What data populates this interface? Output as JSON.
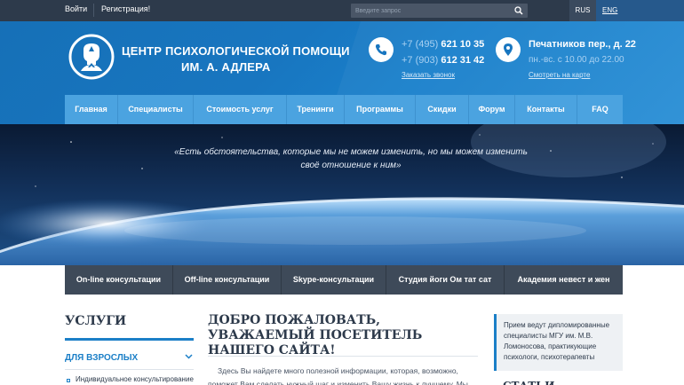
{
  "topbar": {
    "login": "Войти",
    "register": "Регистрация!",
    "search_placeholder": "Введите запрос",
    "lang_rus": "RUS",
    "lang_eng": "ENG"
  },
  "brand": {
    "line1": "ЦЕНТР ПСИХОЛОГИЧЕСКОЙ ПОМОЩИ",
    "line2": "ИМ. А. АДЛЕРА"
  },
  "contacts": {
    "phone1_code": "+7 (495)",
    "phone1_number": "621 10 35",
    "phone2_code": "+7 (903)",
    "phone2_number": "612 31 42",
    "callback": "Заказать звонок",
    "address": "Печатников пер., д. 22",
    "hours": "пн.-вс. с 10.00 до 22.00",
    "map_link": "Смотреть на карте"
  },
  "nav": {
    "items": [
      {
        "label": "Главная"
      },
      {
        "label": "Специалисты"
      },
      {
        "label": "Стоимость услуг"
      },
      {
        "label": "Тренинги"
      },
      {
        "label": "Программы"
      },
      {
        "label": "Скидки"
      },
      {
        "label": "Форум"
      },
      {
        "label": "Контакты"
      },
      {
        "label": "FAQ"
      }
    ]
  },
  "hero": {
    "quote": "«Есть обстоятельства, которые мы не можем изменить, но мы можем изменить своё отношение к ним»"
  },
  "subnav": {
    "items": [
      {
        "label": "On-line консультации"
      },
      {
        "label": "Off-line консультации"
      },
      {
        "label": "Skype-консультации"
      },
      {
        "label": "Студия йоги Ом тат сат"
      },
      {
        "label": "Академия невест и жен"
      }
    ]
  },
  "services": {
    "title": "УСЛУГИ",
    "category": "ДЛЯ ВЗРОСЛЫХ",
    "first_item": "Индивидуальное консультирование"
  },
  "welcome": {
    "title": "ДОБРО ПОЖАЛОВАТЬ, УВАЖАЕМЫЙ ПОСЕТИТЕЛЬ НАШЕГО САЙТА!",
    "line1": "Здесь Вы найдете много полезной информации, которая, возможно,",
    "line2": "поможет Вам сделать нужный шаг и изменить Вашу жизнь к лучшему. Мы"
  },
  "sidebar_note": {
    "text": "Прием ведут дипломированные специалисты МГУ им. М.В. Ломоносова, практикующие психологи, психотерапевты",
    "articles_title": "СТАТЬИ"
  },
  "colors": {
    "accent": "#1b7fc7",
    "topbar": "#2d3a4b",
    "nav": "#4ba3e0",
    "subnav": "#3e4a59"
  }
}
